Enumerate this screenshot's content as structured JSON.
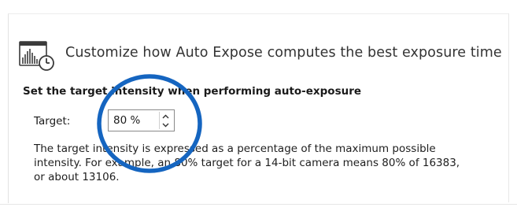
{
  "header": {
    "title": "Customize how Auto Expose computes the best exposure time",
    "icon": "exposure-histogram-clock-icon"
  },
  "section": {
    "heading": "Set the target intensity when performing auto-exposure"
  },
  "target": {
    "label": "Target:",
    "value": "80 %",
    "up_icon": "chevron-up-icon",
    "down_icon": "chevron-down-icon"
  },
  "description": {
    "lines": [
      "The target intensity is expressed as a percentage of the maximum possible",
      "intensity. For example, an 80% target for a 14-bit camera means 80% of 16383,",
      "or about 13106."
    ]
  },
  "colors": {
    "highlight_ring": "#1565c0",
    "icon_stroke": "#3a3a3a",
    "icon_accent": "#2e7d32"
  }
}
